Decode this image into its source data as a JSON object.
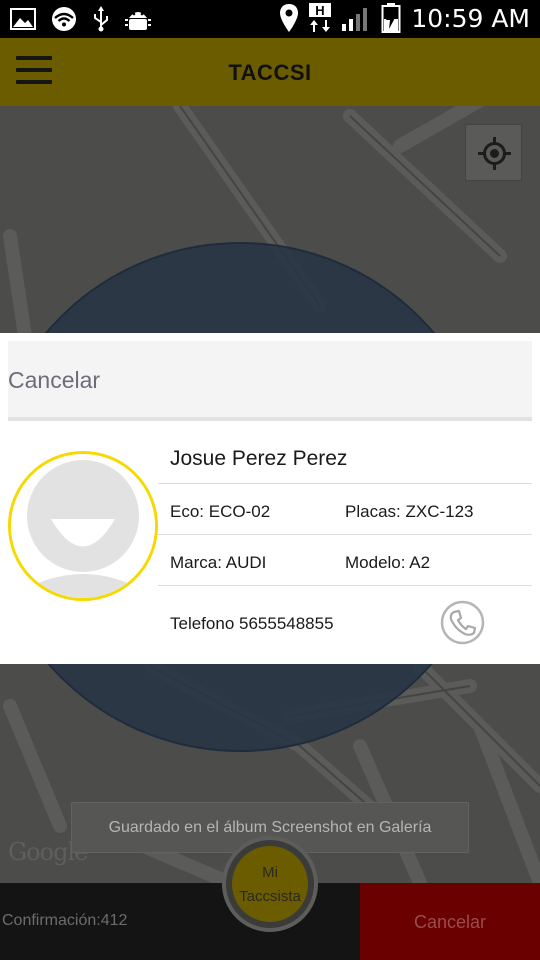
{
  "status_bar": {
    "time": "10:59 AM",
    "icons": [
      "gallery-icon",
      "wifi-icon",
      "usb-icon",
      "android-debug-icon",
      "location-icon",
      "h-data-icon",
      "signal-icon",
      "battery-charging-icon"
    ]
  },
  "app_bar": {
    "title": "TACCSI",
    "menu_icon": "hamburger-menu-icon"
  },
  "map": {
    "locate_icon": "my-location-icon",
    "attribution": "Google"
  },
  "dialog": {
    "cancel_label": "Cancelar",
    "driver_name": "Josue Perez Perez",
    "eco": "Eco: ECO-02",
    "placas": "Placas: ZXC-123",
    "marca": "Marca: AUDI",
    "modelo": "Modelo: A2",
    "telefono": "Telefono 5655548855",
    "phone_icon": "phone-call-icon",
    "avatar_icon": "default-avatar-icon"
  },
  "toast": {
    "message": "Guardado en el álbum Screenshot en Galería"
  },
  "bottom_bar": {
    "confirmation": "Confirmación:412",
    "cancel_label": "Cancelar",
    "center_button_line1": "Mi",
    "center_button_line2": "Taccsista"
  },
  "colors": {
    "brand_yellow": "#f5d900",
    "app_bar_dimmed": "#6b5c00",
    "cancel_red_dimmed": "#6a0000"
  }
}
